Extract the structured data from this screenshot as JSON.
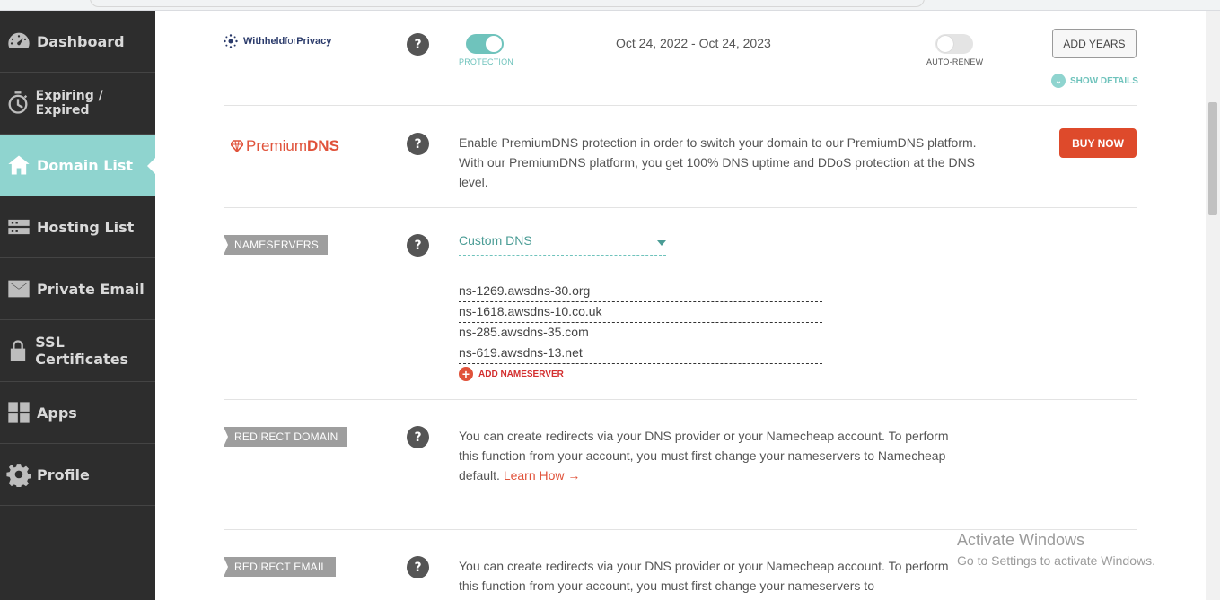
{
  "sidebar": {
    "items": [
      {
        "label": "Dashboard",
        "icon": "dashboard-gauge-icon"
      },
      {
        "label": "Expiring / Expired",
        "icon": "clock-icon"
      },
      {
        "label": "Domain List",
        "icon": "home-icon",
        "active": true
      },
      {
        "label": "Hosting List",
        "icon": "server-icon"
      },
      {
        "label": "Private Email",
        "icon": "envelope-icon"
      },
      {
        "label": "SSL Certificates",
        "icon": "lock-icon"
      },
      {
        "label": "Apps",
        "icon": "apps-grid-icon"
      },
      {
        "label": "Profile",
        "icon": "gear-icon"
      }
    ]
  },
  "privacy": {
    "logo_bold": "Withheld",
    "logo_thin": "for",
    "logo_bold2": "Privacy",
    "protection_label": "PROTECTION",
    "protection_on": true,
    "date_range": "Oct 24, 2022 - Oct 24, 2023",
    "auto_renew_label": "AUTO-RENEW",
    "auto_renew_on": false,
    "add_years_label": "ADD YEARS",
    "show_details_label": "SHOW DETAILS"
  },
  "premium_dns": {
    "logo_thin": "Premium",
    "logo_bold": "DNS",
    "description": "Enable PremiumDNS protection in order to switch your domain to our PremiumDNS platform. With our PremiumDNS platform, you get 100% DNS uptime and DDoS protection at the DNS level.",
    "buy_label": "BUY NOW"
  },
  "nameservers": {
    "tag": "NAMESERVERS",
    "selected": "Custom DNS",
    "entries": [
      "ns-1269.awsdns-30.org",
      "ns-1618.awsdns-10.co.uk",
      "ns-285.awsdns-35.com",
      "ns-619.awsdns-13.net"
    ],
    "add_label": "ADD NAMESERVER"
  },
  "redirect_domain": {
    "tag": "REDIRECT DOMAIN",
    "text": "You can create redirects via your DNS provider or your Namecheap account. To perform this function from your account, you must first change your nameservers to Namecheap default.",
    "link": "Learn How →"
  },
  "redirect_email": {
    "tag": "REDIRECT EMAIL",
    "text": "You can create redirects via your DNS provider or your Namecheap account. To perform this function from your account, you must first change your nameservers to"
  },
  "help_glyph": "?",
  "watermark": {
    "line1": "Activate Windows",
    "line2": "Go to Settings to activate Windows."
  },
  "colors": {
    "accent_teal": "#8fd4cf",
    "brand_red": "#de4a2b",
    "sidebar_bg": "#2d2d2d"
  }
}
